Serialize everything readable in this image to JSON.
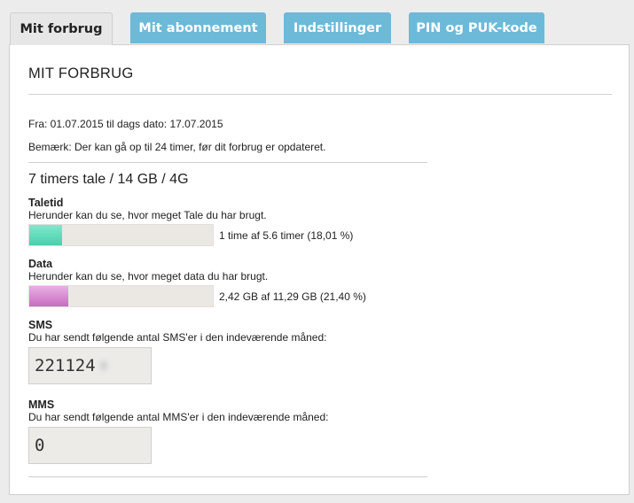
{
  "tabs": [
    {
      "label": "Mit forbrug",
      "active": true
    },
    {
      "label": "Mit abonnement",
      "active": false
    },
    {
      "label": "Indstillinger",
      "active": false
    },
    {
      "label": "PIN og PUK-kode",
      "active": false
    }
  ],
  "section": {
    "title": "MIT FORBRUG",
    "period": "Fra: 01.07.2015 til dags dato: 17.07.2015",
    "note": "Bemærk: Der kan gå op til 24 timer, før dit forbrug er opdateret."
  },
  "plan": {
    "title": "7 timers tale / 14 GB / 4G"
  },
  "talk": {
    "title": "Taletid",
    "desc": "Herunder kan du se, hvor meget Tale du har brugt.",
    "usage_text": "1 time af 5.6 timer (18,01 %)",
    "percent": 18.01
  },
  "data": {
    "title": "Data",
    "desc": "Herunder kan du se, hvor meget data du har brugt.",
    "usage_text": "2,42 GB af 11,29 GB (21,40 %)",
    "percent": 21.4
  },
  "sms": {
    "title": "SMS",
    "desc": "Du har sendt følgende antal SMS'er i den indeværende måned:",
    "count": "221124"
  },
  "mms": {
    "title": "MMS",
    "desc": "Du har sendt følgende antal MMS'er i den indeværende måned:",
    "count": "0"
  },
  "colors": {
    "tab_inactive": "#6db9d8",
    "talk_fill": "#49cfac",
    "data_fill": "#c86cc0"
  }
}
